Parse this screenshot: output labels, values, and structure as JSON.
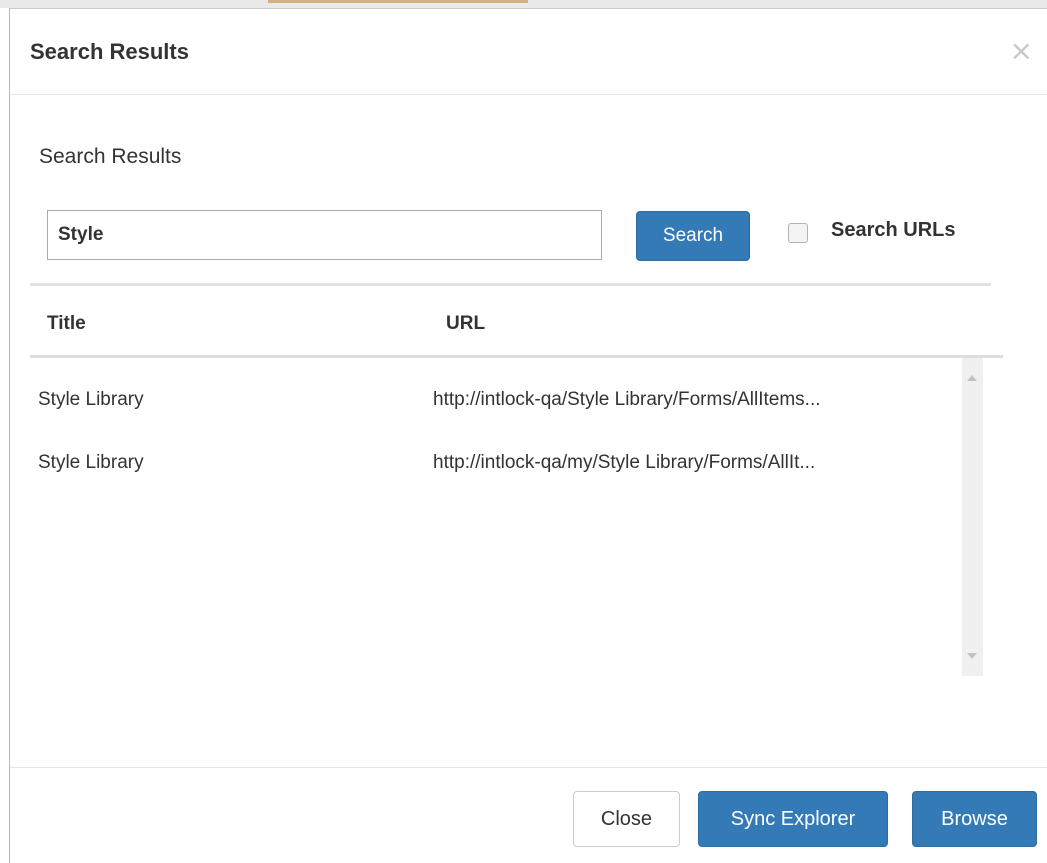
{
  "dialog": {
    "title": "Search Results",
    "close_symbol": "×"
  },
  "search": {
    "section_title": "Search Results",
    "query": "Style",
    "button_label": "Search",
    "search_urls_label": "Search URLs",
    "search_urls_checked": false
  },
  "table": {
    "columns": [
      "Title",
      "URL"
    ],
    "rows": [
      {
        "title": "Style Library",
        "url": "http://intlock-qa/Style Library/Forms/AllItems..."
      },
      {
        "title": "Style Library",
        "url": "http://intlock-qa/my/Style Library/Forms/AllIt..."
      }
    ]
  },
  "footer": {
    "close_label": "Close",
    "sync_label": "Sync Explorer",
    "browse_label": "Browse"
  },
  "colors": {
    "primary": "#337ab7",
    "text": "#333333",
    "border": "#cccccc"
  },
  "icons": {
    "close": "close-icon",
    "scroll_up": "scroll-up-arrow-icon",
    "scroll_down": "scroll-down-arrow-icon"
  }
}
